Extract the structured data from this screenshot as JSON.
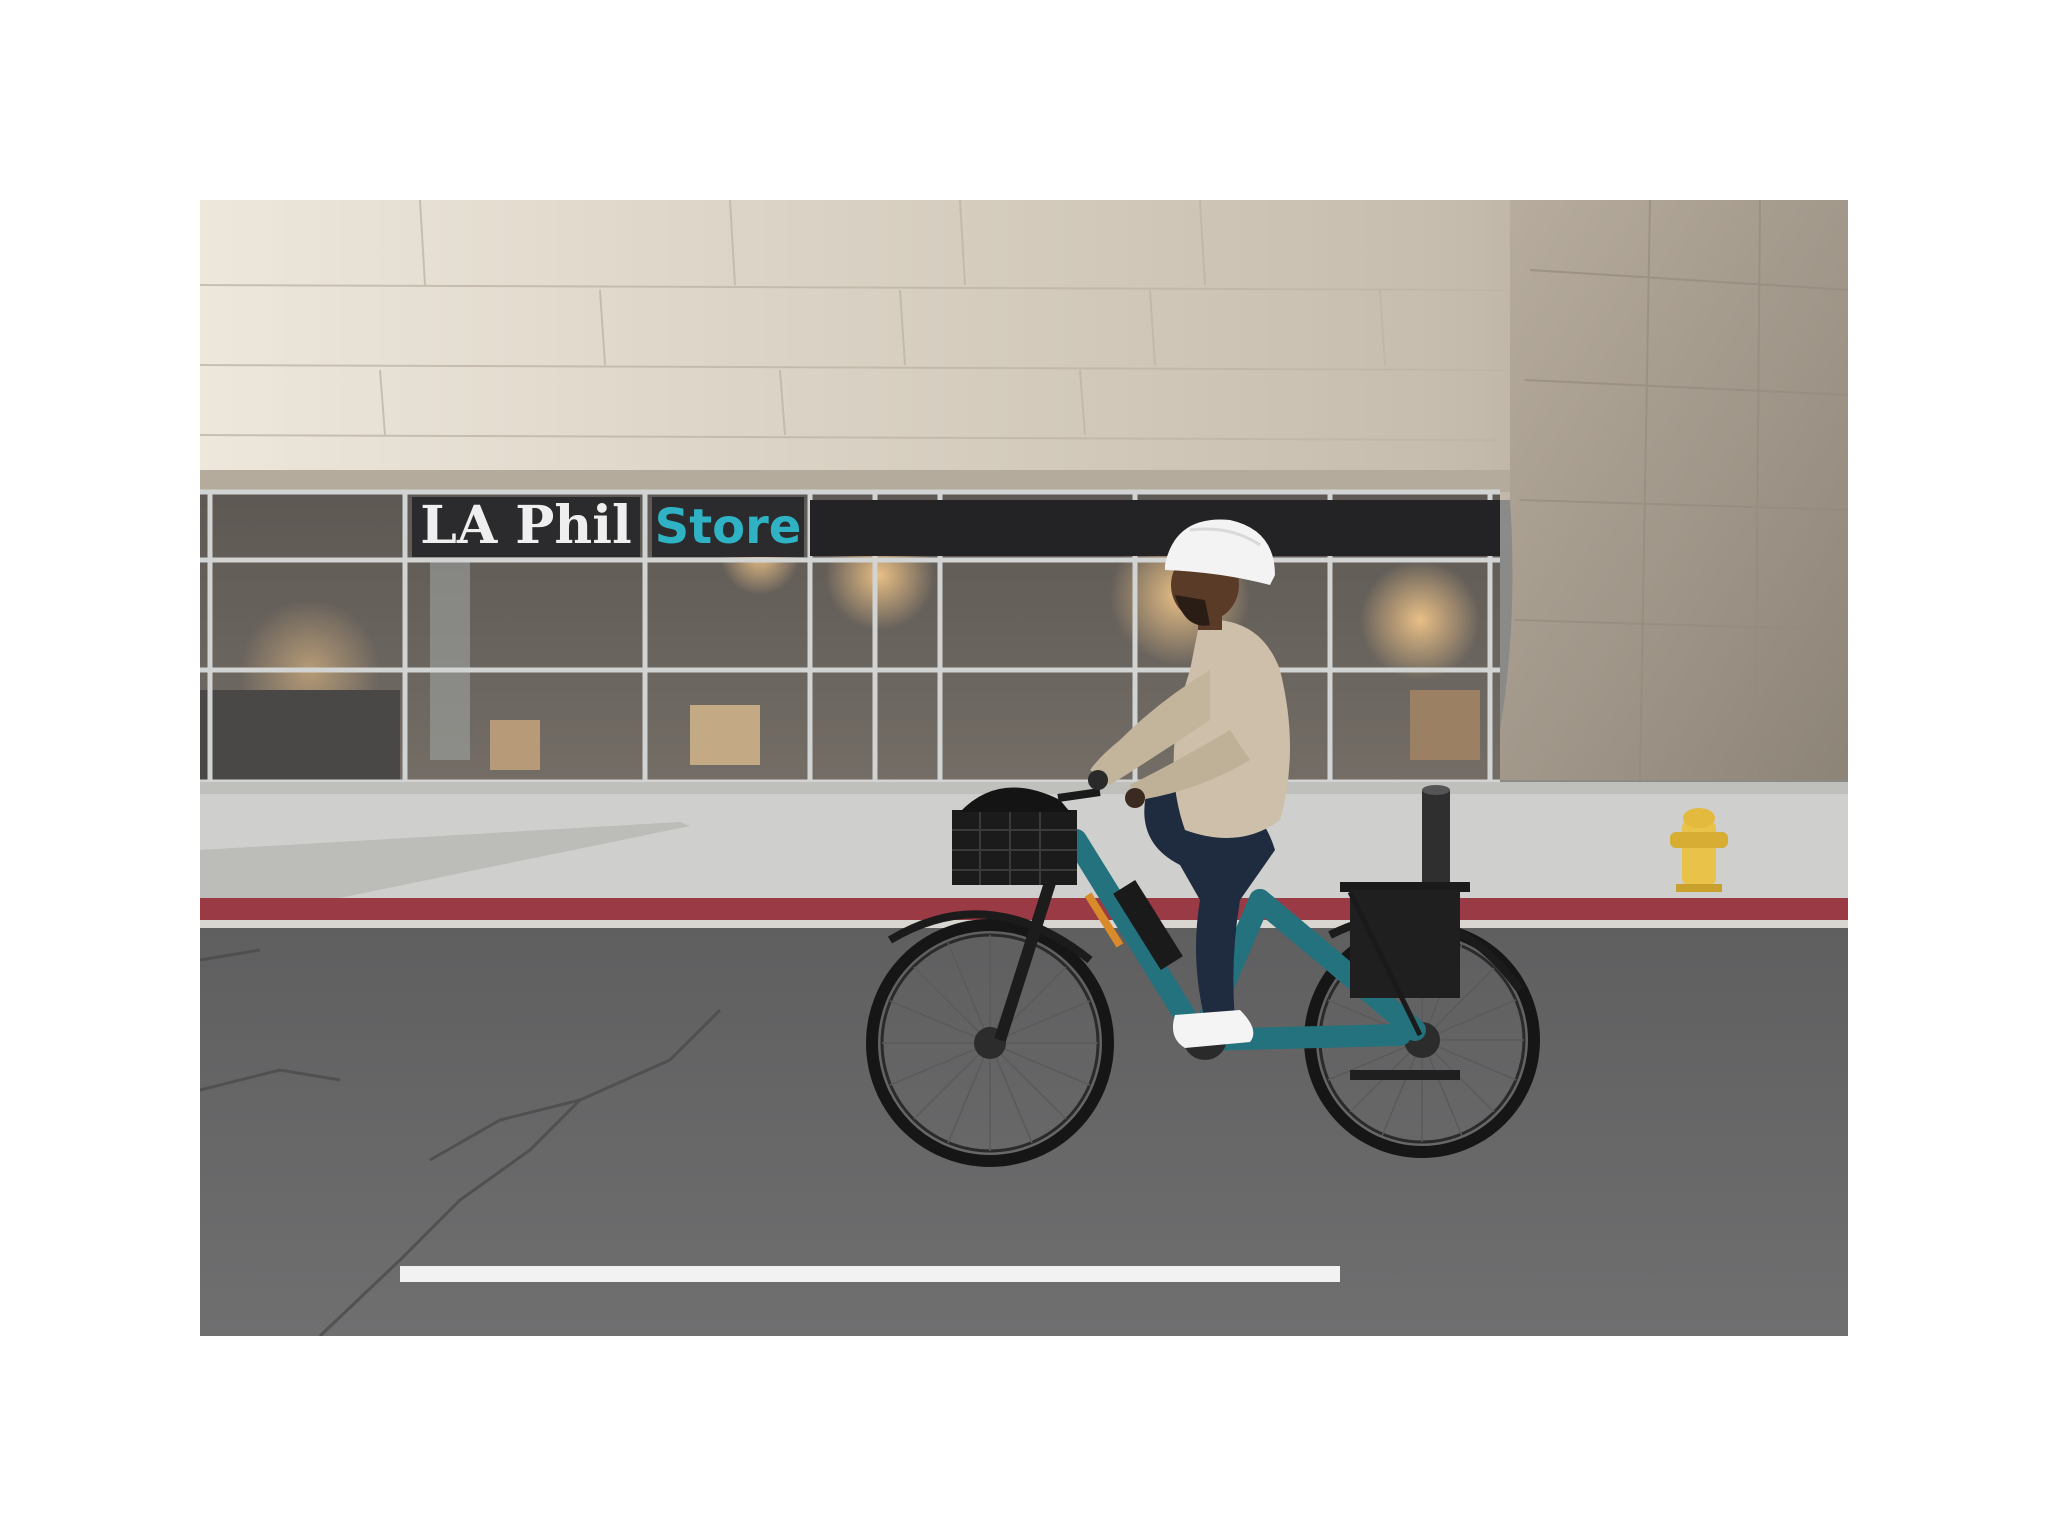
{
  "photo": {
    "store_sign": {
      "brand": "LA Phil",
      "word": "Store"
    },
    "colors": {
      "background": "#ffffff",
      "facade_light": "#d8d1c4",
      "facade_dark": "#a59d92",
      "sign_panel": "#2b2b2d",
      "sign_text": "#efefef",
      "store_teal": "#2fb3c4",
      "sidewalk": "#cfcfcd",
      "curb_red": "#9a3a44",
      "road": "#6b6b6c",
      "lane_marking": "#f2f2f2",
      "bike_frame": "#23727e",
      "jacket": "#cdbfa9",
      "helmet": "#f3f3f3",
      "jeans": "#1f2b3f",
      "hydrant": "#e9c24a"
    }
  }
}
